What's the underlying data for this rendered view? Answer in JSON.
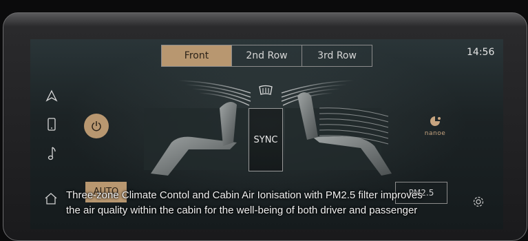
{
  "tabs": [
    "Front",
    "2nd Row",
    "3rd Row"
  ],
  "active_tab": "Front",
  "clock": "14:56",
  "sidebar": {
    "items": [
      {
        "icon": "navigation-icon"
      },
      {
        "icon": "phone-icon"
      },
      {
        "icon": "music-note-icon"
      }
    ]
  },
  "center": {
    "sync_label": "SYNC",
    "defrost_icon": "rear-defrost-icon",
    "power_icon": "power-icon"
  },
  "nanoe": {
    "label": "nanoe"
  },
  "bottom": {
    "auto_label": "AUTO",
    "pm_label": "PM2.5"
  },
  "caption": {
    "line1": "Three-zone Climate Contol and Cabin Air Ionisation with PM2.5 filter improves",
    "line2": "the air quality within the cabin for the well-being of both driver and passenger"
  },
  "colors": {
    "accent": "#b89770",
    "screen_bg": "#1c2325",
    "text": "#e4e4e4"
  }
}
